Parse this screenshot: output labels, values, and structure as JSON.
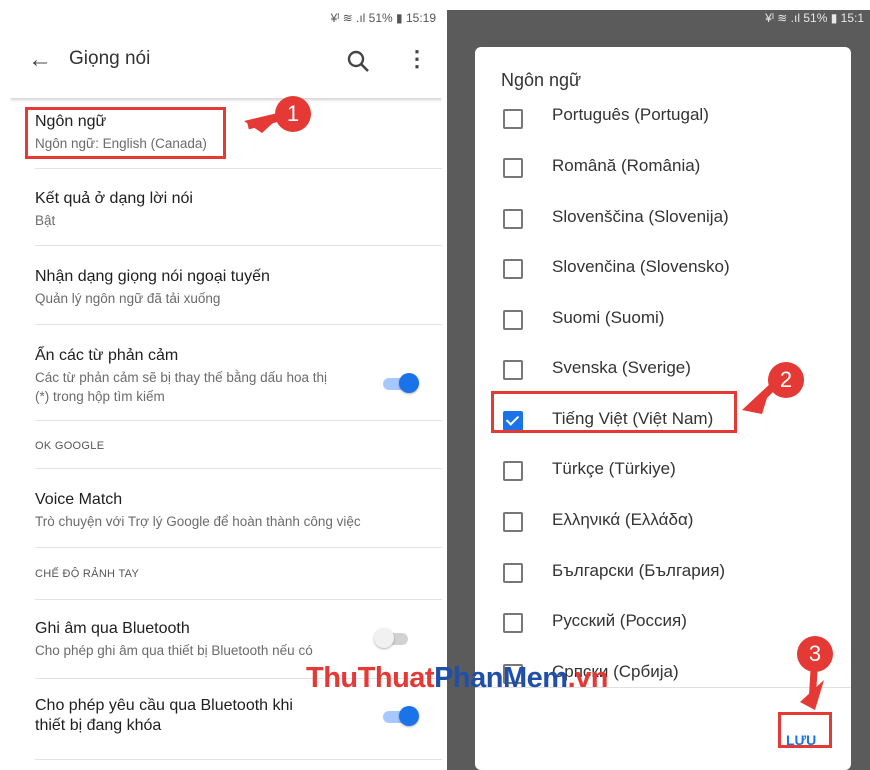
{
  "left": {
    "status_text": "¥ᴵ ≋ .ıl 51% ▮ 15:19",
    "appbar": {
      "back_icon": "arrow-left-icon",
      "title": "Giọng nói",
      "search_icon": "search-icon",
      "more_icon": "more-vert-icon"
    },
    "items": [
      {
        "title": "Ngôn ngữ",
        "subtitle": "Ngôn ngữ: English (Canada)"
      },
      {
        "title": "Kết quả ở dạng lời nói",
        "subtitle": "Bật"
      },
      {
        "title": "Nhận dạng giọng nói ngoại tuyến",
        "subtitle": "Quản lý ngôn ngữ đã tải xuống"
      },
      {
        "title": "Ẩn các từ phản cảm",
        "subtitle_line1": "Các từ phản cảm sẽ bị thay thế bằng dấu hoa thị",
        "subtitle_line2": "(*) trong hộp tìm kiếm",
        "toggle": true
      }
    ],
    "section_ok_google": "OK GOOGLE",
    "voice_match": {
      "title": "Voice Match",
      "subtitle": "Trò chuyện với Trợ lý Google để hoàn thành công việc"
    },
    "section_hands_free": "CHẾ ĐỘ RẢNH TAY",
    "bluetooth_record": {
      "title": "Ghi âm qua Bluetooth",
      "subtitle": "Cho phép ghi âm qua thiết bị Bluetooth nếu có",
      "toggle": false
    },
    "bluetooth_locked": {
      "title_line1": "Cho phép yêu cầu qua Bluetooth khi",
      "title_line2": "thiết bị đang khóa",
      "toggle": true
    }
  },
  "right": {
    "status_text": "¥ᴵ ≋ .ıl 51% ▮ 15:1",
    "dialog_title": "Ngôn ngữ",
    "options": [
      {
        "label": "Português (Portugal)",
        "checked": false
      },
      {
        "label": "Română (România)",
        "checked": false
      },
      {
        "label": "Slovenščina (Slovenija)",
        "checked": false
      },
      {
        "label": "Slovenčina (Slovensko)",
        "checked": false
      },
      {
        "label": "Suomi (Suomi)",
        "checked": false
      },
      {
        "label": "Svenska (Sverige)",
        "checked": false
      },
      {
        "label": "Tiếng Việt (Việt Nam)",
        "checked": true
      },
      {
        "label": "Türkçe (Türkiye)",
        "checked": false
      },
      {
        "label": "Ελληνικά (Ελλάδα)",
        "checked": false
      },
      {
        "label": "Български (България)",
        "checked": false
      },
      {
        "label": "Русский (Россия)",
        "checked": false
      },
      {
        "label": "Српски (Србија)",
        "checked": false
      }
    ],
    "save_label": "LƯU"
  },
  "annotations": {
    "step1": "1",
    "step2": "2",
    "step3": "3",
    "color": "#e53935"
  },
  "watermark": {
    "part1": "ThuThuat",
    "part2": "PhanMem",
    "part3": ".vn"
  },
  "colors": {
    "accent": "#1a73e8",
    "annotation": "#e53935"
  }
}
